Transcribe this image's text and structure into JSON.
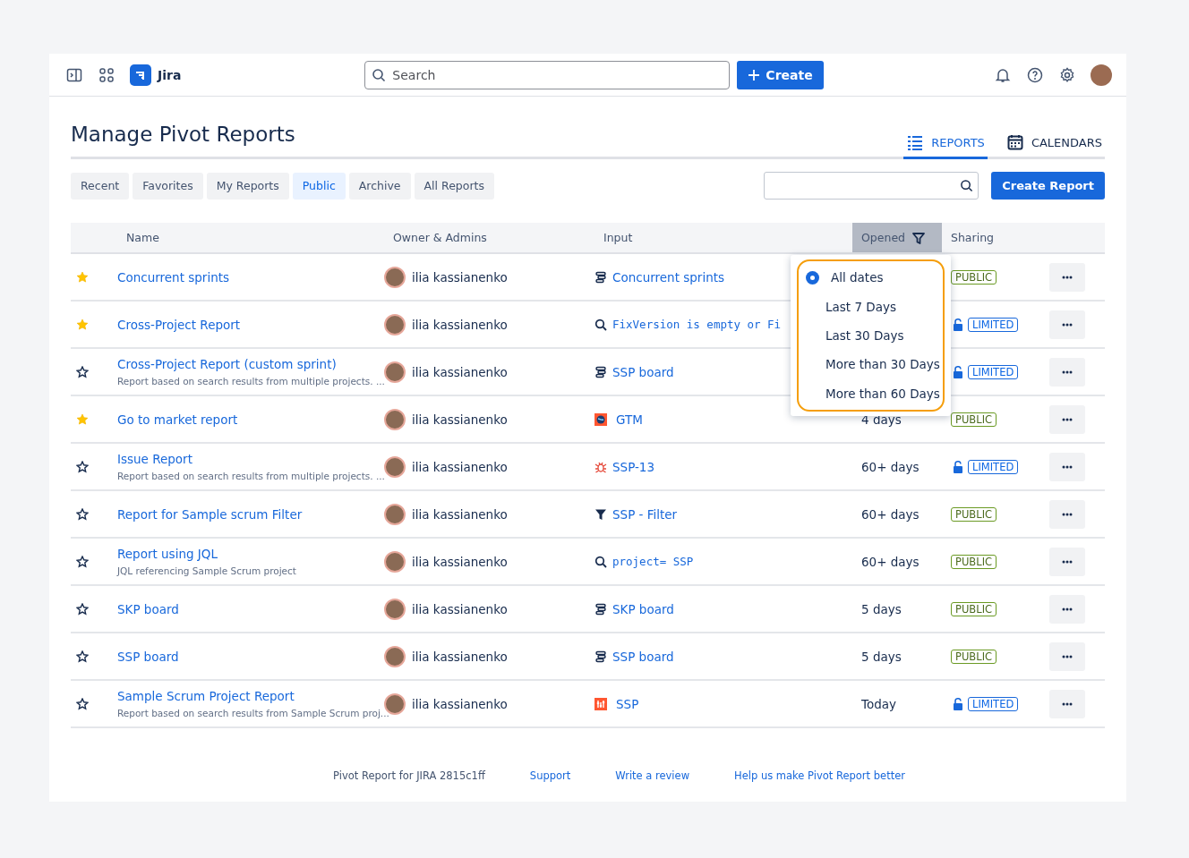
{
  "topbar": {
    "app_name": "Jira",
    "search": {
      "placeholder": "Search"
    },
    "create_label": "Create"
  },
  "page_title": "Manage Pivot Reports",
  "view_tabs": [
    {
      "label": "REPORTS",
      "selected": true
    },
    {
      "label": "CALENDARS",
      "selected": false
    }
  ],
  "filter_tabs": [
    {
      "label": "Recent",
      "selected": false
    },
    {
      "label": "Favorites",
      "selected": false
    },
    {
      "label": "My Reports",
      "selected": false
    },
    {
      "label": "Public",
      "selected": true
    },
    {
      "label": "Archive",
      "selected": false
    },
    {
      "label": "All Reports",
      "selected": false
    }
  ],
  "create_report_label": "Create Report",
  "table": {
    "columns": [
      {
        "label": "Name",
        "filter_active": false
      },
      {
        "label": "Owner & Admins",
        "filter_active": false
      },
      {
        "label": "Input",
        "filter_active": false
      },
      {
        "label": "Opened",
        "filter_active": true
      },
      {
        "label": "Sharing",
        "filter_active": false
      }
    ],
    "rows": [
      {
        "favorite": true,
        "name": "Concurrent sprints",
        "owner": "ilia kassianenko",
        "input": {
          "kind": "board",
          "text": "Concurrent sprints"
        },
        "sharing": {
          "kind": "public",
          "label": "PUBLIC"
        }
      },
      {
        "favorite": true,
        "name": "Cross-Project Report",
        "owner": "ilia kassianenko",
        "input": {
          "kind": "jql",
          "text": "FixVersion is empty or Fi"
        },
        "sharing": {
          "kind": "limited",
          "label": "LIMITED"
        }
      },
      {
        "favorite": false,
        "name": "Cross-Project Report (custom sprint)",
        "description": "Report based on search results from multiple projects. ...",
        "owner": "ilia kassianenko",
        "input": {
          "kind": "board",
          "text": "SSP board"
        },
        "sharing": {
          "kind": "limited",
          "label": "LIMITED"
        }
      },
      {
        "favorite": true,
        "name": "Go to market report",
        "owner": "ilia kassianenko",
        "input": {
          "kind": "project-globe",
          "text": "GTM"
        },
        "opened": "4 days",
        "sharing": {
          "kind": "public",
          "label": "PUBLIC"
        }
      },
      {
        "favorite": false,
        "name": "Issue Report",
        "description": "Report based on search results from multiple projects. ...",
        "owner": "ilia kassianenko",
        "input": {
          "kind": "issue",
          "text": "SSP-13"
        },
        "opened": "60+ days",
        "sharing": {
          "kind": "limited",
          "label": "LIMITED"
        }
      },
      {
        "favorite": false,
        "name": "Report for Sample scrum Filter",
        "owner": "ilia kassianenko",
        "input": {
          "kind": "filter",
          "text": "SSP - Filter"
        },
        "opened": "60+ days",
        "sharing": {
          "kind": "public",
          "label": "PUBLIC"
        }
      },
      {
        "favorite": false,
        "name": "Report using JQL",
        "description": "JQL referencing Sample Scrum project",
        "owner": "ilia kassianenko",
        "input": {
          "kind": "jql",
          "text": "project= SSP"
        },
        "opened": "60+ days",
        "sharing": {
          "kind": "public",
          "label": "PUBLIC"
        }
      },
      {
        "favorite": false,
        "name": "SKP board",
        "owner": "ilia kassianenko",
        "input": {
          "kind": "board",
          "text": "SKP board"
        },
        "opened": "5 days",
        "sharing": {
          "kind": "public",
          "label": "PUBLIC"
        }
      },
      {
        "favorite": false,
        "name": "SSP board",
        "owner": "ilia kassianenko",
        "input": {
          "kind": "board",
          "text": "SSP board"
        },
        "opened": "5 days",
        "sharing": {
          "kind": "public",
          "label": "PUBLIC"
        }
      },
      {
        "favorite": false,
        "name": "Sample Scrum Project Report",
        "description": "Report based on search results from Sample Scrum proj...",
        "owner": "ilia kassianenko",
        "input": {
          "kind": "project-bars",
          "text": "SSP"
        },
        "opened": "Today",
        "sharing": {
          "kind": "limited",
          "label": "LIMITED"
        }
      }
    ]
  },
  "opened_menu": {
    "options": [
      {
        "label": "All dates",
        "selected": true
      },
      {
        "label": "Last 7 Days",
        "selected": false
      },
      {
        "label": "Last 30 Days",
        "selected": false
      },
      {
        "label": "More than 30 Days",
        "selected": false
      },
      {
        "label": "More than 60 Days",
        "selected": false
      }
    ]
  },
  "footer": [
    {
      "label": "Pivot Report for JIRA 2815c1ff",
      "kind": "text"
    },
    {
      "label": "Support",
      "kind": "link"
    },
    {
      "label": "Write a review",
      "kind": "link"
    },
    {
      "label": "Help us make Pivot Report better",
      "kind": "link"
    }
  ]
}
